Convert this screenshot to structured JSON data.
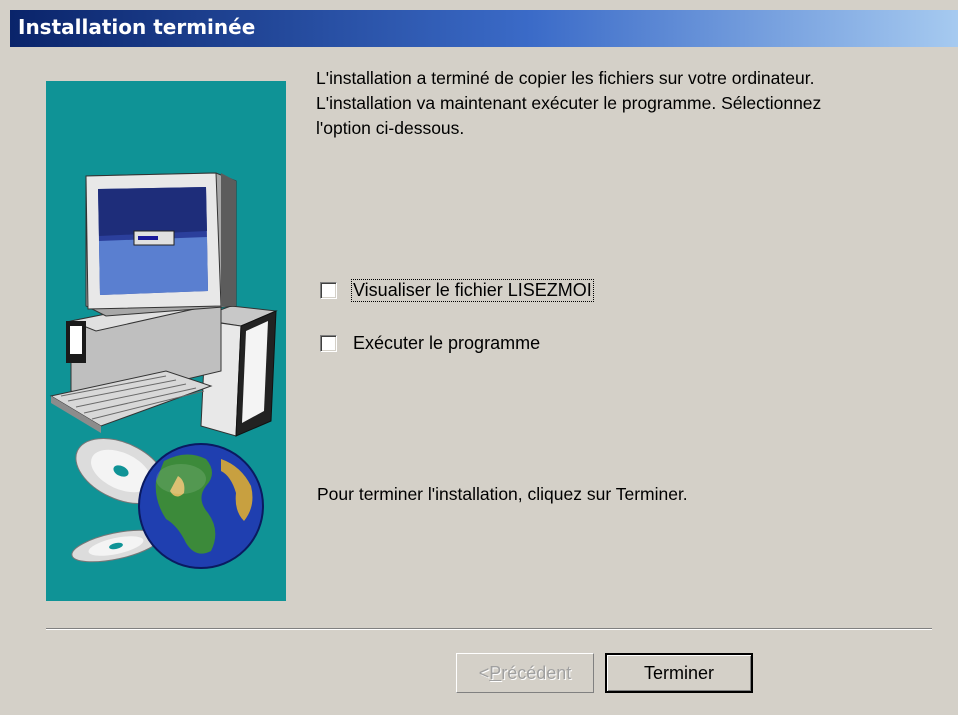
{
  "window": {
    "title": "Installation terminée"
  },
  "content": {
    "message_line1": "L'installation a terminé de copier les fichiers sur votre ordinateur.",
    "message_line2": "L'installation va maintenant exécuter le programme. Sélectionnez",
    "message_line3": "l'option ci-dessous.",
    "finish_text": "Pour terminer l'installation, cliquez sur Terminer."
  },
  "options": {
    "readme": {
      "label": "Visualiser le fichier LISEZMOI",
      "checked": false
    },
    "run": {
      "label": "Exécuter le programme",
      "checked": false
    }
  },
  "buttons": {
    "back_prefix": "< ",
    "back_accel": "P",
    "back_rest": "récédent",
    "back_enabled": false,
    "finish": "Terminer"
  },
  "illustration": {
    "icons": [
      "computer-icon",
      "cd-discs-icon",
      "globe-icon"
    ],
    "panel_color": "#0f9396"
  },
  "colors": {
    "titlebar_start": "#0a246a",
    "titlebar_end": "#a6caf0",
    "dialog_bg": "#d4d0c8"
  }
}
